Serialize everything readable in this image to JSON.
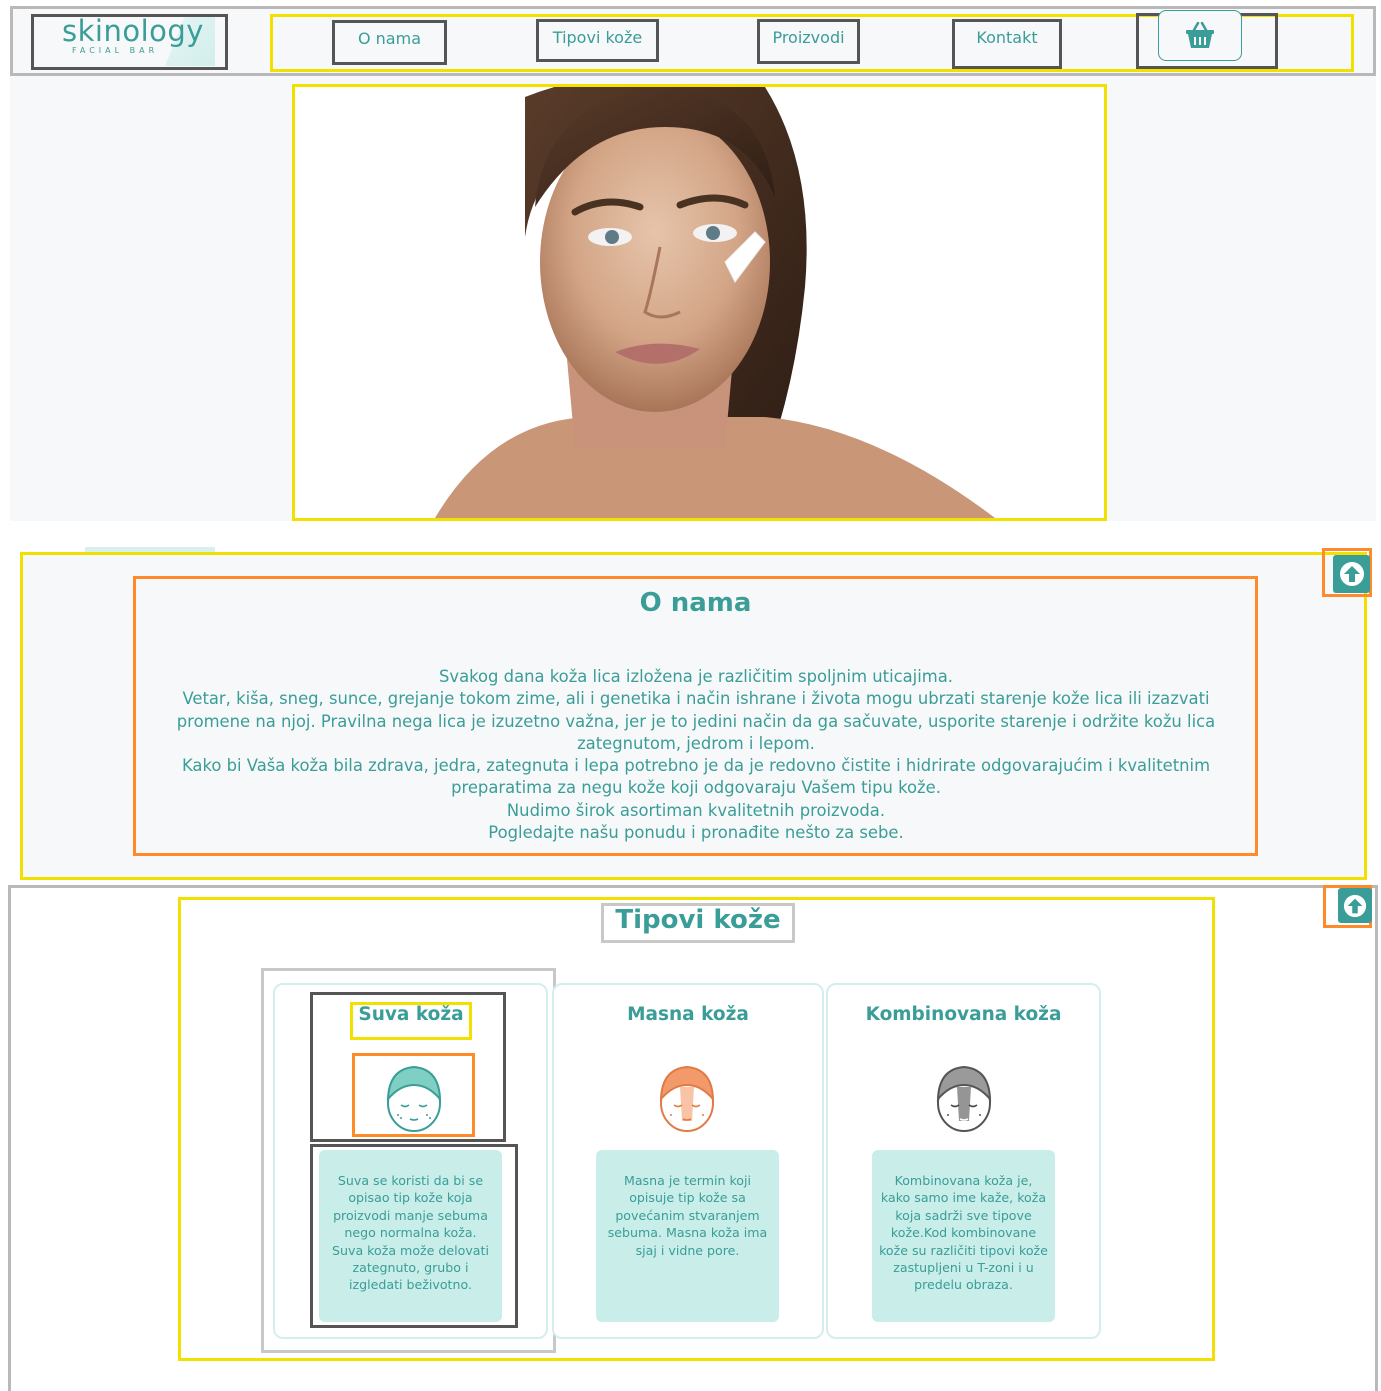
{
  "brand": {
    "name": "skinology",
    "tagline": "FACIAL BAR",
    "color": "#3a9d98"
  },
  "nav": {
    "items": [
      "O nama",
      "Tipovi kože",
      "Proizvodi",
      "Kontakt"
    ],
    "cart_icon": "basket-icon"
  },
  "hero": {
    "image_desc_icon": "woman-face-cream-photo"
  },
  "about": {
    "title": "O nama",
    "lines": [
      "Svakog dana koža lica izložena je različitim spoljnim uticajima.",
      "Vetar, kiša, sneg, sunce, grejanje tokom zime, ali i genetika i način ishrane i života mogu ubrzati starenje kože lica ili izazvati",
      "promene na njoj. Pravilna nega lica je izuzetno važna, jer je to jedini način da ga sačuvate, usporite starenje i održite kožu lica",
      "zategnutom, jedrom i lepom.",
      "Kako bi Vaša koža bila zdrava, jedra, zategnuta i lepa potrebno je da je redovno čistite i hidrirate odgovarajućim i kvalitetnim",
      "preparatima za negu kože koji odgovaraju Vašem tipu kože.",
      "Nudimo širok asortiman kvalitetnih proizvoda.",
      "Pogledajte našu ponudu i pronađite nešto za sebe."
    ],
    "scroll_up_icon": "arrow-up-icon"
  },
  "skin_types": {
    "title": "Tipovi kože",
    "cards": [
      {
        "title": "Suva koža",
        "icon": "face-towel-icon-teal",
        "color": "#7fcfc4",
        "text_lines": [
          "Suva se koristi da bi se",
          "opisao tip kože koja",
          "proizvodi manje sebuma",
          "nego normalna koža.",
          "Suva koža može delovati",
          "zategnuto, grubo i",
          "izgledati beživotno."
        ]
      },
      {
        "title": "Masna koža",
        "icon": "face-towel-icon-orange",
        "color": "#f29a6a",
        "text_lines": [
          "Masna je termin koji",
          "opisuje tip kože sa",
          "povećanim stvaranjem",
          "sebuma. Masna koža ima",
          "sjaj i vidne pore."
        ]
      },
      {
        "title": "Kombinovana koža",
        "icon": "face-towel-icon-grey",
        "color": "#8a8a8a",
        "text_lines": [
          "Kombinovana koža je,",
          "kako samo ime kaže, koža",
          "koja sadrži sve tipove",
          "kože.Kod kombinovane",
          "kože su različiti tipovi kože",
          "zastupljeni u T-zoni i u",
          "predelu obraza."
        ]
      }
    ]
  }
}
